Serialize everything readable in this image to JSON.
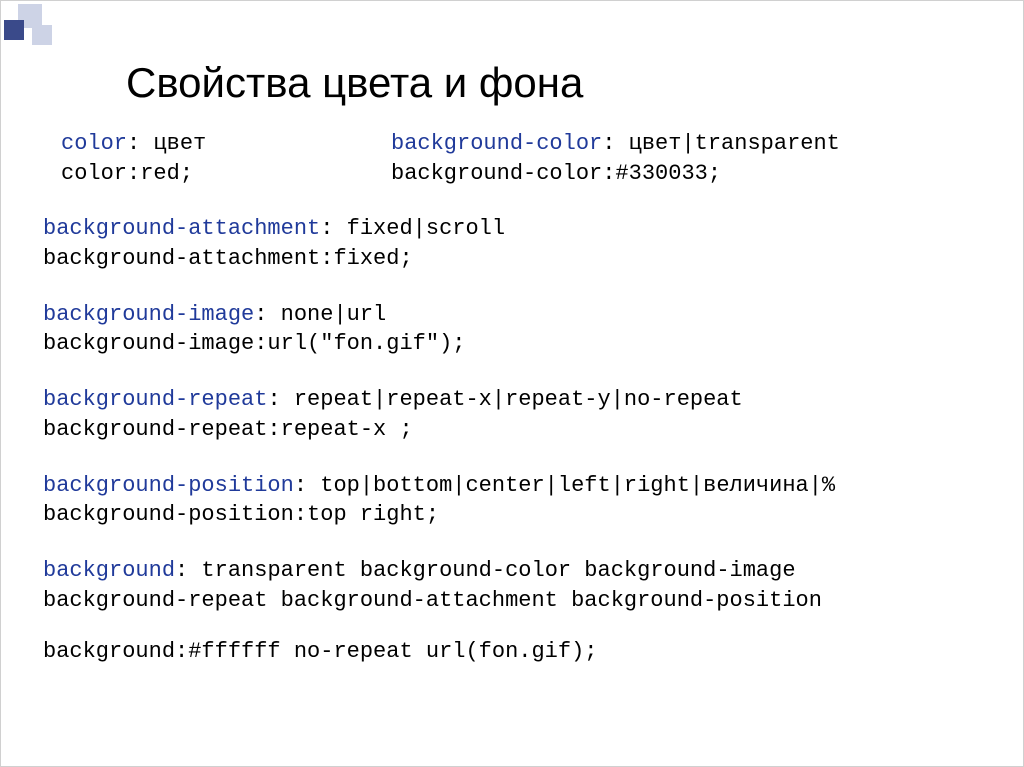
{
  "title": "Свойства цвета и фона",
  "top": {
    "left": {
      "syntax_kw": "color",
      "syntax_rest": ": цвет",
      "example": "color:red;"
    },
    "right": {
      "syntax_kw": "background-color",
      "syntax_rest": ": цвет|transparent",
      "example": "background-color:#330033;"
    }
  },
  "blocks": [
    {
      "kw": "background-attachment",
      "rest": ": fixed|scroll",
      "example": "background-attachment:fixed;"
    },
    {
      "kw": "background-image",
      "rest": ": none|url",
      "example": "background-image:url(\"fon.gif\");"
    },
    {
      "kw": "background-repeat",
      "rest": ": repeat|repeat-x|repeat-y|no-repeat",
      "example": "background-repeat:repeat-x ;"
    },
    {
      "kw": "background-position",
      "rest": ": top|bottom|center|left|right|величина|%",
      "example": "background-position:top right;"
    }
  ],
  "bg": {
    "kw": "background",
    "rest": ": transparent background-color background-image",
    "line2": "background-repeat background-attachment  background-position",
    "example": "background:#ffffff no-repeat url(fon.gif);"
  }
}
